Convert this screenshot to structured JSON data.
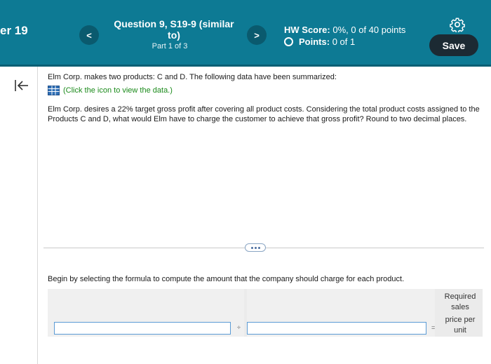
{
  "header": {
    "chapter_label": "er 19",
    "question_title": "Question 9, S19-9 (similar to)",
    "part_label": "Part 1 of 3",
    "prev_label": "<",
    "next_label": ">",
    "hw_score_label": "HW Score:",
    "hw_score_value": "0%, 0 of 40 points",
    "points_label": "Points:",
    "points_value": "0 of 1",
    "save_label": "Save",
    "settings_icon": "gear-icon"
  },
  "sidebar": {
    "collapse_icon": "collapse-left-icon"
  },
  "question": {
    "intro": "Elm Corp. makes two products: C and D. The following data have been summarized:",
    "data_link": "(Click the icon to view the data.)",
    "body": "Elm Corp. desires a 22% target gross profit after covering all product costs. Considering the total product costs assigned to the Products C and D, what would Elm have to charge the customer to achieve that gross profit? Round to two decimal places."
  },
  "step": {
    "instruction": "Begin by selecting the formula to compute the amount that the company should charge for each product.",
    "operator_divide": "÷",
    "operator_equals": "=",
    "result_label_1": "Required sales",
    "result_label_2": "price per unit",
    "input_1_value": "",
    "input_2_value": ""
  },
  "colors": {
    "header_bg": "#0d7a94",
    "save_button_bg": "#1c2a33",
    "link_color": "#1a8a1a"
  }
}
